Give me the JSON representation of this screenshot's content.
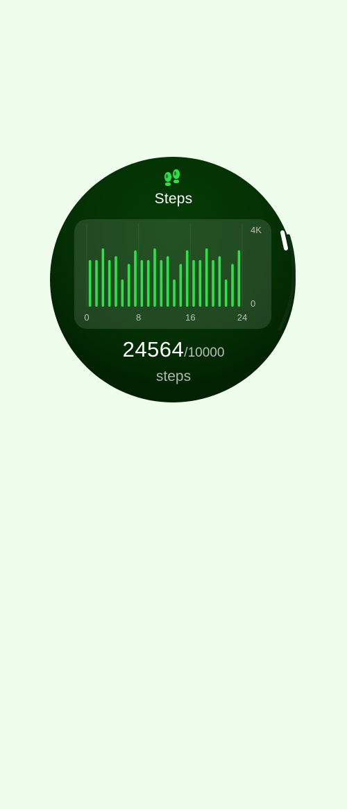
{
  "header": {
    "title": "Steps",
    "icon": "footprints-icon"
  },
  "colors": {
    "background": "#effeec",
    "watch_face": "#043104",
    "bar": "#2ee04a",
    "accent_icon": "#2ee04a",
    "text_primary": "#ffffff",
    "text_secondary": "#b7bdb7"
  },
  "summary": {
    "value": "24564",
    "goal": "/10000",
    "unit": "steps"
  },
  "chart_data": {
    "type": "bar",
    "title": "",
    "x_ticks": [
      "0",
      "8",
      "16",
      "24"
    ],
    "y_ticks": [
      "0",
      "4K"
    ],
    "ylim": [
      0,
      4000
    ],
    "xlim": [
      0,
      24
    ],
    "grid": "vertical at 0, 8, 16, 24",
    "values": [
      2400,
      2400,
      3000,
      2400,
      2600,
      1400,
      2200,
      2900,
      2400,
      2400,
      3000,
      2400,
      2600,
      1400,
      2200,
      2900,
      2400,
      2400,
      3000,
      2400,
      2600,
      1400,
      2200,
      2900
    ]
  }
}
